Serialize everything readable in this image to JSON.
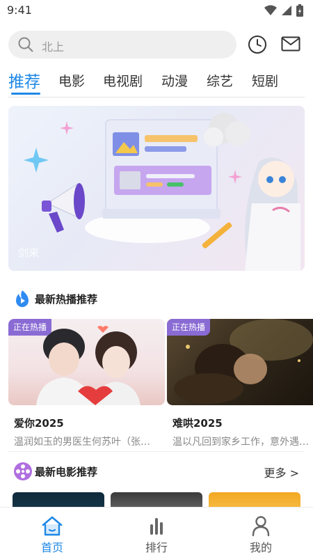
{
  "status_bar": {
    "time": "9:41"
  },
  "search": {
    "placeholder": "北上"
  },
  "tabs": [
    {
      "label": "推荐",
      "active": true
    },
    {
      "label": "电影"
    },
    {
      "label": "电视剧"
    },
    {
      "label": "动漫"
    },
    {
      "label": "综艺"
    },
    {
      "label": "短剧"
    }
  ],
  "banner": {
    "caption": "剑来"
  },
  "hot_section": {
    "title": "最新热播推荐",
    "cards": [
      {
        "badge": "正在热播",
        "title": "爱你2025",
        "desc": "温润如玉的男医生何苏叶（张…"
      },
      {
        "badge": "正在热播",
        "title": "难哄2025",
        "desc": "温以凡回到家乡工作，意外遇…"
      }
    ]
  },
  "movie_section": {
    "title": "最新电影推荐",
    "more_label": "更多 >"
  },
  "bottom_nav": [
    {
      "label": "首页",
      "icon": "home-icon",
      "active": true
    },
    {
      "label": "排行",
      "icon": "ranking-icon"
    },
    {
      "label": "我的",
      "icon": "profile-icon"
    }
  ],
  "colors": {
    "accent": "#1e88e5",
    "badge": "#8a6bd4"
  }
}
